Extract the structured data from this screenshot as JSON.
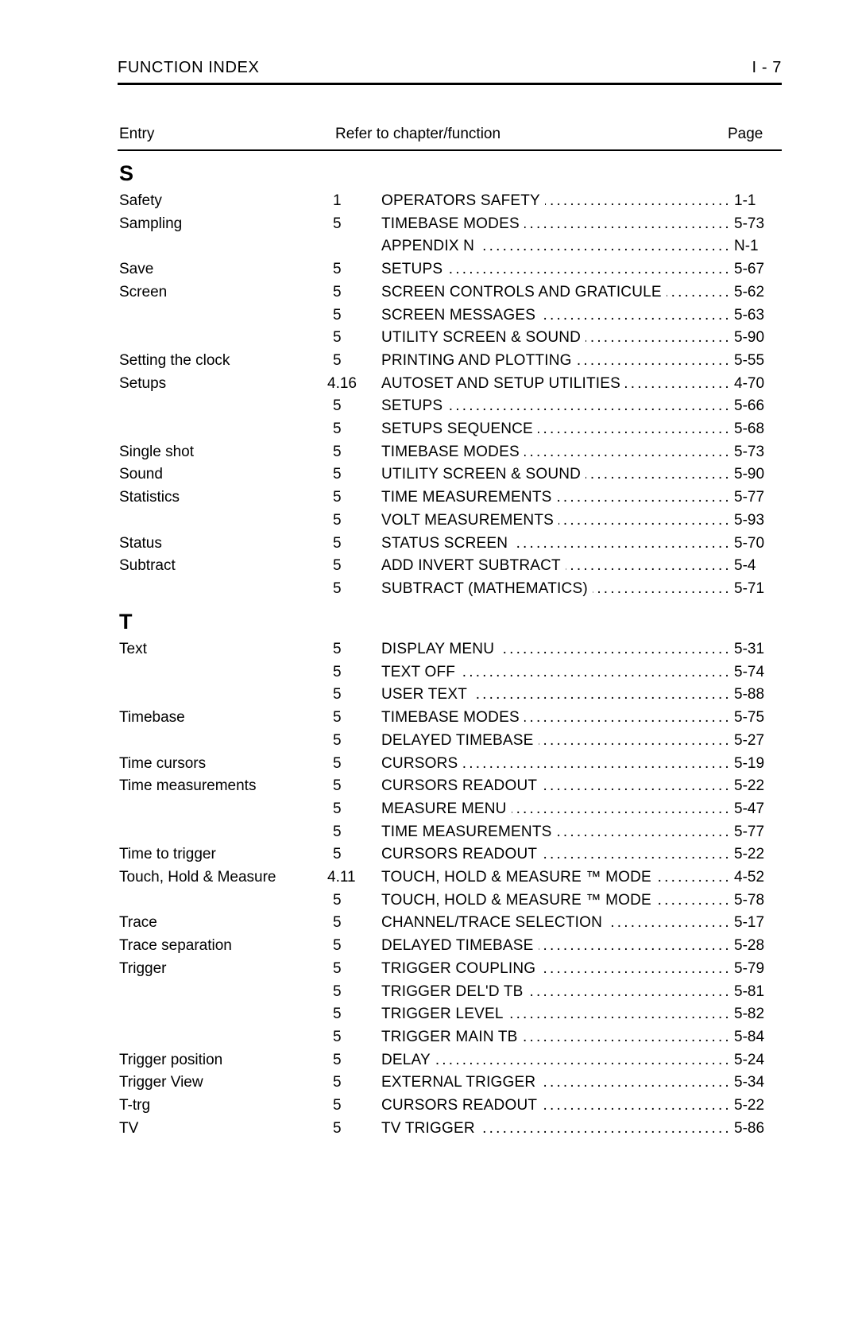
{
  "header": {
    "title": "FUNCTION INDEX",
    "page_label": "I - 7"
  },
  "columns": {
    "entry": "Entry",
    "refer": "Refer to chapter/function",
    "page": "Page"
  },
  "sections": [
    {
      "letter": "S",
      "rows": [
        {
          "entry": "Safety",
          "chapter": "1",
          "function": "OPERATORS SAFETY",
          "page": "1-1"
        },
        {
          "entry": "Sampling",
          "chapter": "5",
          "function": "TIMEBASE MODES",
          "page": "5-73"
        },
        {
          "entry": "",
          "chapter": "",
          "function": "APPENDIX N",
          "page": "N-1"
        },
        {
          "entry": "Save",
          "chapter": "5",
          "function": "SETUPS",
          "page": "5-67"
        },
        {
          "entry": "Screen",
          "chapter": "5",
          "function": "SCREEN CONTROLS AND GRATICULE",
          "page": "5-62"
        },
        {
          "entry": "",
          "chapter": "5",
          "function": "SCREEN MESSAGES",
          "page": "5-63"
        },
        {
          "entry": "",
          "chapter": "5",
          "function": "UTILITY SCREEN & SOUND",
          "page": "5-90"
        },
        {
          "entry": "Setting the clock",
          "chapter": "5",
          "function": "PRINTING AND PLOTTING",
          "page": "5-55"
        },
        {
          "entry": "Setups",
          "chapter": "4.16",
          "function": "AUTOSET AND SETUP UTILITIES",
          "page": "4-70"
        },
        {
          "entry": "",
          "chapter": "5",
          "function": "SETUPS",
          "page": "5-66"
        },
        {
          "entry": "",
          "chapter": "5",
          "function": "SETUPS SEQUENCE",
          "page": "5-68"
        },
        {
          "entry": "Single shot",
          "chapter": "5",
          "function": "TIMEBASE MODES",
          "page": "5-73"
        },
        {
          "entry": "Sound",
          "chapter": "5",
          "function": "UTILITY SCREEN & SOUND",
          "page": "5-90"
        },
        {
          "entry": "Statistics",
          "chapter": "5",
          "function": "TIME MEASUREMENTS",
          "page": "5-77"
        },
        {
          "entry": "",
          "chapter": "5",
          "function": "VOLT MEASUREMENTS",
          "page": "5-93"
        },
        {
          "entry": "Status",
          "chapter": "5",
          "function": "STATUS SCREEN",
          "page": "5-70"
        },
        {
          "entry": "Subtract",
          "chapter": "5",
          "function": "ADD INVERT SUBTRACT",
          "page": "5-4"
        },
        {
          "entry": "",
          "chapter": "5",
          "function": "SUBTRACT (MATHEMATICS)",
          "page": "5-71"
        }
      ]
    },
    {
      "letter": "T",
      "rows": [
        {
          "entry": "Text",
          "chapter": "5",
          "function": "DISPLAY MENU",
          "page": "5-31"
        },
        {
          "entry": "",
          "chapter": "5",
          "function": "TEXT OFF",
          "page": "5-74"
        },
        {
          "entry": "",
          "chapter": "5",
          "function": "USER TEXT",
          "page": "5-88"
        },
        {
          "entry": "Timebase",
          "chapter": "5",
          "function": "TIMEBASE MODES",
          "page": "5-75"
        },
        {
          "entry": "",
          "chapter": "5",
          "function": "DELAYED TIMEBASE",
          "page": "5-27"
        },
        {
          "entry": "Time cursors",
          "chapter": "5",
          "function": "CURSORS",
          "page": "5-19"
        },
        {
          "entry": "Time measurements",
          "chapter": "5",
          "function": "CURSORS READOUT",
          "page": "5-22"
        },
        {
          "entry": "",
          "chapter": "5",
          "function": "MEASURE MENU",
          "page": "5-47"
        },
        {
          "entry": "",
          "chapter": "5",
          "function": "TIME MEASUREMENTS",
          "page": "5-77"
        },
        {
          "entry": "Time to trigger",
          "chapter": "5",
          "function": "CURSORS READOUT",
          "page": "5-22"
        },
        {
          "entry": "Touch, Hold & Measure",
          "chapter": "4.11",
          "function": "TOUCH, HOLD & MEASURE ™ MODE",
          "page": "4-52"
        },
        {
          "entry": "",
          "chapter": "5",
          "function": "TOUCH, HOLD & MEASURE ™ MODE",
          "page": "5-78"
        },
        {
          "entry": "Trace",
          "chapter": "5",
          "function": "CHANNEL/TRACE SELECTION",
          "page": "5-17"
        },
        {
          "entry": "Trace separation",
          "chapter": "5",
          "function": "DELAYED TIMEBASE",
          "page": "5-28"
        },
        {
          "entry": "Trigger",
          "chapter": "5",
          "function": "TRIGGER COUPLING",
          "page": "5-79"
        },
        {
          "entry": "",
          "chapter": "5",
          "function": "TRIGGER DEL'D TB",
          "page": "5-81"
        },
        {
          "entry": "",
          "chapter": "5",
          "function": "TRIGGER LEVEL",
          "page": "5-82"
        },
        {
          "entry": "",
          "chapter": "5",
          "function": "TRIGGER MAIN TB",
          "page": "5-84"
        },
        {
          "entry": "Trigger position",
          "chapter": "5",
          "function": "DELAY",
          "page": "5-24"
        },
        {
          "entry": "Trigger View",
          "chapter": "5",
          "function": "EXTERNAL TRIGGER",
          "page": "5-34"
        },
        {
          "entry": "T-trg",
          "chapter": "5",
          "function": "CURSORS READOUT",
          "page": "5-22"
        },
        {
          "entry": "TV",
          "chapter": "5",
          "function": "TV TRIGGER",
          "page": "5-86"
        }
      ]
    }
  ]
}
